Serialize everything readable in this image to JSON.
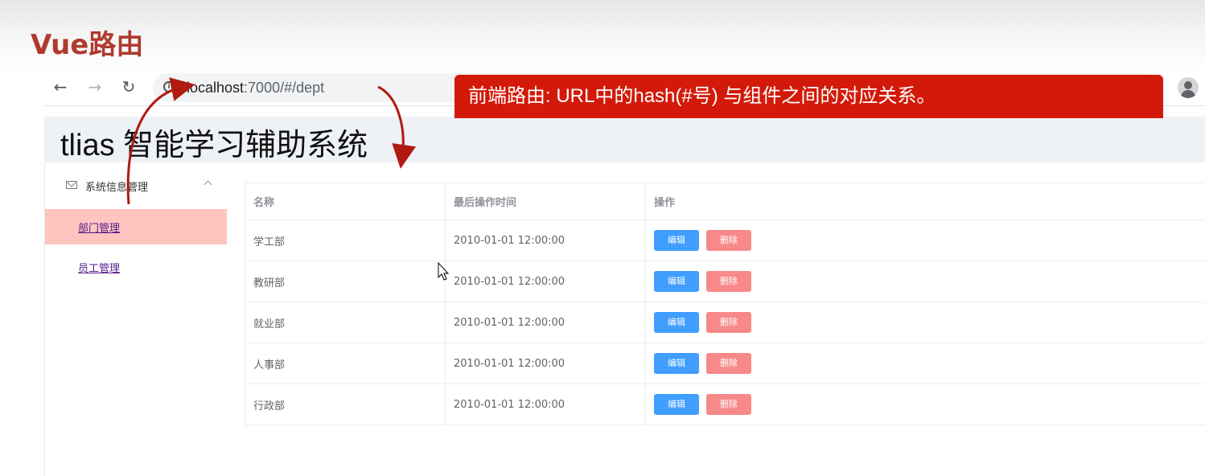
{
  "slide": {
    "title": "Vue路由"
  },
  "browser": {
    "back_icon": "arrow-left-icon",
    "forward_icon": "arrow-right-icon",
    "reload_icon": "reload-icon",
    "url_host": "localhost",
    "url_rest": ":7000/#/dept",
    "profile_icon": "person-icon"
  },
  "callout": {
    "text": "前端路由: URL中的hash(#号) 与组件之间的对应关系。",
    "color": "#d31a0a"
  },
  "app": {
    "title": "tlias 智能学习辅助系统",
    "sidebar": {
      "group_label": "系统信息管理",
      "items": [
        {
          "label": "部门管理",
          "active": true
        },
        {
          "label": "员工管理",
          "active": false
        }
      ]
    },
    "table": {
      "headers": [
        "名称",
        "最后操作时间",
        "操作"
      ],
      "rows": [
        {
          "name": "学工部",
          "time": "2010-01-01 12:00:00"
        },
        {
          "name": "教研部",
          "time": "2010-01-01 12:00:00"
        },
        {
          "name": "就业部",
          "time": "2010-01-01 12:00:00"
        },
        {
          "name": "人事部",
          "time": "2010-01-01 12:00:00"
        },
        {
          "name": "行政部",
          "time": "2010-01-01 12:00:00"
        }
      ],
      "edit_label": "编辑",
      "delete_label": "删除"
    }
  },
  "colors": {
    "accent": "#409eff",
    "danger": "#f78989",
    "active_menu": "#fec5c0",
    "title": "#b03a2e"
  }
}
